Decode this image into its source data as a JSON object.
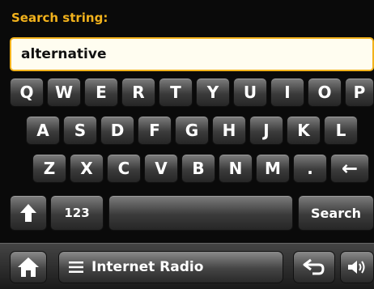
{
  "search": {
    "label": "Search string:",
    "value": "alternative"
  },
  "keyboard": {
    "row1": [
      "Q",
      "W",
      "E",
      "R",
      "T",
      "Y",
      "U",
      "I",
      "O",
      "P"
    ],
    "row2": [
      "A",
      "S",
      "D",
      "F",
      "G",
      "H",
      "J",
      "K",
      "L"
    ],
    "row3": [
      "Z",
      "X",
      "C",
      "V",
      "B",
      "N",
      "M",
      "."
    ],
    "backspace": "←",
    "shift": "⬆",
    "numbers": "123",
    "search": "Search"
  },
  "bottom_bar": {
    "home_icon": "house-icon",
    "menu_icon": "menu-icon",
    "menu_label": "Internet Radio",
    "back_icon": "back-arrow-icon",
    "volume_icon": "speaker-icon"
  },
  "colors": {
    "accent": "#f2b21c",
    "background": "#0a0a0a"
  }
}
